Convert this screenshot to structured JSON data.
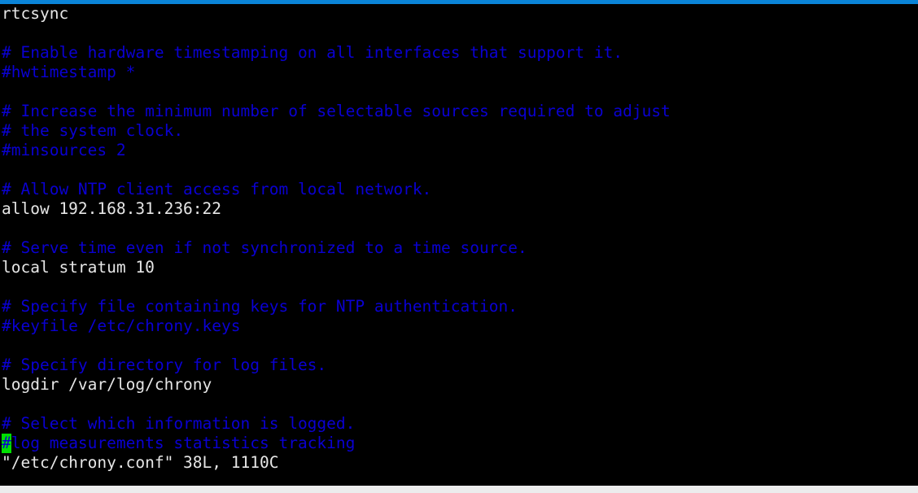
{
  "window": {
    "app": "terminal",
    "program": "vim",
    "top_accent_color": "#0a84d8",
    "bottom_chrome_color": "#ececed",
    "background_color": "#000000"
  },
  "colors": {
    "normal_text": "#e6e6e6",
    "comment_text": "#0a00d2",
    "cursor_background": "#00e000",
    "cursor_foreground": "#0a00d2"
  },
  "editor": {
    "file_path": "/etc/chrony.conf",
    "status_line": "\"/etc/chrony.conf\" 38L, 1110C",
    "line_count_label": "38L",
    "char_count_label": "1110C",
    "cursor": {
      "character": "#",
      "line_text_after_cursor": "log measurements statistics tracking"
    },
    "lines": [
      {
        "role": "normal",
        "text": "rtcsync"
      },
      {
        "role": "blank",
        "text": ""
      },
      {
        "role": "comment",
        "text": "# Enable hardware timestamping on all interfaces that support it."
      },
      {
        "role": "comment",
        "text": "#hwtimestamp *"
      },
      {
        "role": "blank",
        "text": ""
      },
      {
        "role": "comment",
        "text": "# Increase the minimum number of selectable sources required to adjust"
      },
      {
        "role": "comment",
        "text": "# the system clock."
      },
      {
        "role": "comment",
        "text": "#minsources 2"
      },
      {
        "role": "blank",
        "text": ""
      },
      {
        "role": "comment",
        "text": "# Allow NTP client access from local network."
      },
      {
        "role": "normal",
        "text": "allow 192.168.31.236:22"
      },
      {
        "role": "blank",
        "text": ""
      },
      {
        "role": "comment",
        "text": "# Serve time even if not synchronized to a time source."
      },
      {
        "role": "normal",
        "text": "local stratum 10"
      },
      {
        "role": "blank",
        "text": ""
      },
      {
        "role": "comment",
        "text": "# Specify file containing keys for NTP authentication."
      },
      {
        "role": "comment",
        "text": "#keyfile /etc/chrony.keys"
      },
      {
        "role": "blank",
        "text": ""
      },
      {
        "role": "comment",
        "text": "# Specify directory for log files."
      },
      {
        "role": "normal",
        "text": "logdir /var/log/chrony"
      },
      {
        "role": "blank",
        "text": ""
      },
      {
        "role": "comment",
        "text": "# Select which information is logged."
      }
    ]
  }
}
